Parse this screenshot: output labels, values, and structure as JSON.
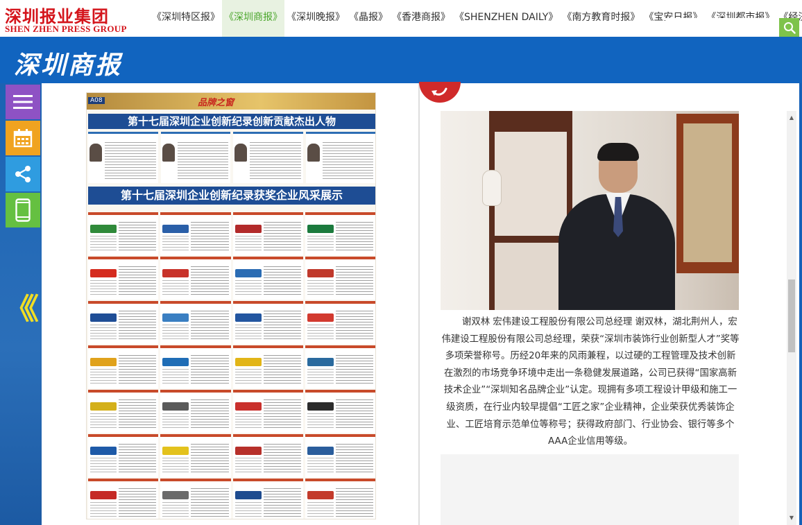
{
  "header": {
    "logo_cn": "深圳报业集团",
    "logo_en": "SHEN ZHEN PRESS GROUP",
    "nav": [
      {
        "label": "《深圳特区报》",
        "active": false
      },
      {
        "label": "《深圳商报》",
        "active": true
      },
      {
        "label": "《深圳晚报》",
        "active": false
      },
      {
        "label": "《晶报》",
        "active": false
      },
      {
        "label": "《香港商报》",
        "active": false
      },
      {
        "label": "《SHENZHEN DAILY》",
        "active": false
      },
      {
        "label": "《南方教育时报》",
        "active": false
      },
      {
        "label": "《宝安日报》",
        "active": false
      },
      {
        "label": "《深圳都市报》",
        "active": false
      },
      {
        "label": "《经济导",
        "active": false
      }
    ]
  },
  "band": {
    "paper_title": "深圳商报",
    "search": {
      "value": "",
      "placeholder": ""
    },
    "search_icon": "search-icon"
  },
  "tools": [
    {
      "name": "menu-icon"
    },
    {
      "name": "calendar-icon"
    },
    {
      "name": "share-icon"
    },
    {
      "name": "mobile-icon"
    }
  ],
  "prev_page_icon": "double-chevron-left-icon",
  "accent_colors": {
    "nav_active": "#49a52a",
    "brand_red": "#d4141b",
    "band_blue": "#1164bf"
  },
  "newspaper": {
    "page_no": "A08",
    "banner": "品牌之窗",
    "headline_1": "第十七届深圳企业创新纪录创新贡献杰出人物",
    "headline_2": "第十七届深圳企业创新纪录获奖企业风采展示"
  },
  "article": {
    "caption": "谢双林 宏伟建设工程股份有限公司总经理 谢双林，湖北荆州人，宏伟建设工程股份有限公司总经理，荣获“深圳市装饰行业创新型人才”奖等多项荣誉称号。历经20年来的风雨兼程，以过硬的工程管理及技术创新在激烈的市场竞争环境中走出一条稳健发展道路，公司已获得“国家高新技术企业”“深圳知名品牌企业”认定。现拥有多项工程设计甲级和施工一级资质，在行业内较早提倡“工匠之家”企业精神，企业荣获优秀装饰企业、工匠培育示范单位等称号；获得政府部门、行业协会、银行等多个AAA企业信用等级。"
  }
}
